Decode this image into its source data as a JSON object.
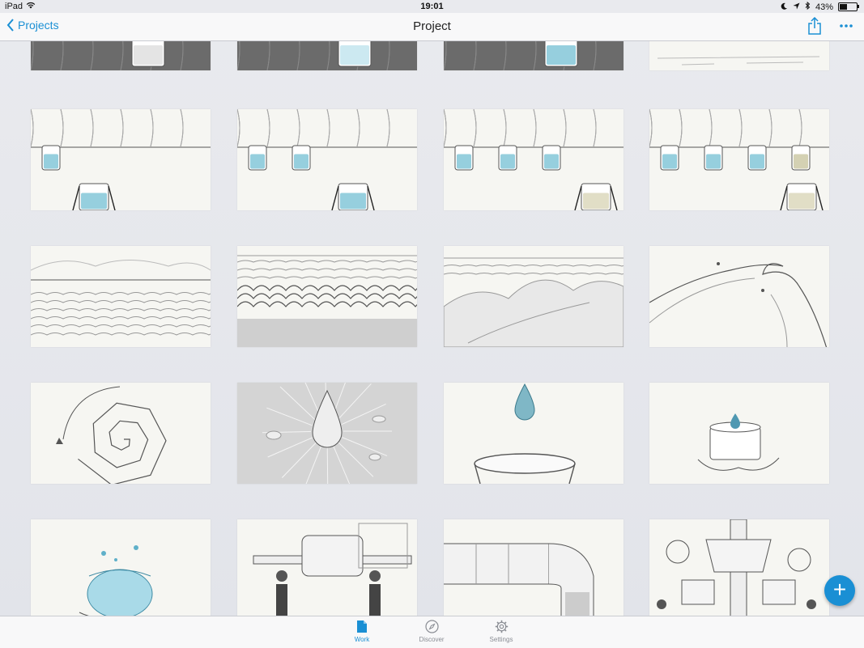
{
  "status_bar": {
    "device": "iPad",
    "time": "19:01",
    "battery": "43%",
    "battery_level": 0.43
  },
  "nav": {
    "back_label": "Projects",
    "title": "Project",
    "share_icon": "share-icon",
    "more_icon": "more-icon"
  },
  "tabs": [
    {
      "label": "Work",
      "icon": "document-icon",
      "active": true
    },
    {
      "label": "Discover",
      "icon": "compass-icon",
      "active": false
    },
    {
      "label": "Settings",
      "icon": "gear-icon",
      "active": false
    }
  ],
  "fab": {
    "label": "+",
    "icon": "plus-icon"
  },
  "storyboard": {
    "tiles": [
      {
        "scene": "dark-glass",
        "variant": 1
      },
      {
        "scene": "dark-glass",
        "variant": 2
      },
      {
        "scene": "dark-glass",
        "variant": 3
      },
      {
        "scene": "light-sketch",
        "variant": 0
      },
      {
        "scene": "glasses-row",
        "variant": 1
      },
      {
        "scene": "glasses-row",
        "variant": 2
      },
      {
        "scene": "glasses-row",
        "variant": 3
      },
      {
        "scene": "glasses-row",
        "variant": 4
      },
      {
        "scene": "ocean-calm",
        "variant": 0
      },
      {
        "scene": "ocean-waves",
        "variant": 0
      },
      {
        "scene": "wave-splash",
        "variant": 0
      },
      {
        "scene": "wave-curl",
        "variant": 0
      },
      {
        "scene": "spiral",
        "variant": 0
      },
      {
        "scene": "droplet-burst",
        "variant": 0
      },
      {
        "scene": "droplet-bowl",
        "variant": 0
      },
      {
        "scene": "hands-cup",
        "variant": 0
      },
      {
        "scene": "splash-bowl",
        "variant": 0
      },
      {
        "scene": "factory-tank",
        "variant": 0
      },
      {
        "scene": "pipe-elbow",
        "variant": 0
      },
      {
        "scene": "machinery",
        "variant": 0
      }
    ]
  }
}
